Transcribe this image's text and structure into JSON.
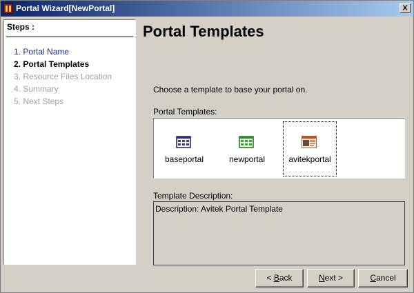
{
  "window": {
    "title": "Portal Wizard[NewPortal]",
    "close_label": "X"
  },
  "steps": {
    "title": "Steps :",
    "items": [
      {
        "label": "1. Portal Name",
        "state": "done"
      },
      {
        "label": "2. Portal Templates",
        "state": "current"
      },
      {
        "label": "3. Resource Files Location",
        "state": "future"
      },
      {
        "label": "4. Summary",
        "state": "future"
      },
      {
        "label": "5. Next Steps",
        "state": "future"
      }
    ]
  },
  "main": {
    "heading": "Portal Templates",
    "prompt": "Choose a template to base your portal on.",
    "templates_label": "Portal Templates:",
    "templates": [
      {
        "name": "baseportal",
        "icon": "layout-grid-icon",
        "selected": false
      },
      {
        "name": "newportal",
        "icon": "green-grid-icon",
        "selected": false
      },
      {
        "name": "avitekportal",
        "icon": "thumbnail-image-icon",
        "selected": true
      }
    ],
    "description_label": "Template Description:",
    "description_text": "Description: Avitek Portal Template"
  },
  "buttons": {
    "back": {
      "prefix": "< ",
      "mnemonic": "B",
      "rest": "ack"
    },
    "next": {
      "mnemonic": "N",
      "rest": "ext >"
    },
    "cancel": {
      "mnemonic": "C",
      "rest": "ancel"
    }
  },
  "colors": {
    "titlebar_start": "#0a246a",
    "titlebar_end": "#a6caf0",
    "face": "#d4d0c8",
    "step_done": "#1c2e8c",
    "step_future": "#a0a0a0"
  }
}
